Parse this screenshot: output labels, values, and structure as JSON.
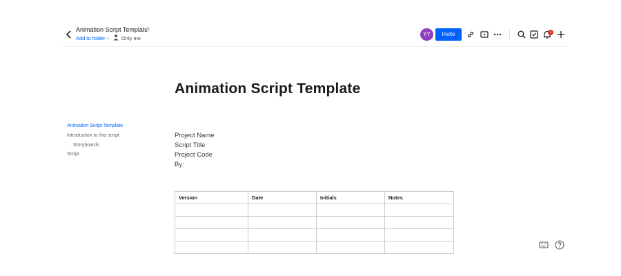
{
  "header": {
    "doc_title": "Animation Script Template",
    "add_to_folder": "Add to folder",
    "separator": "•",
    "sharing": "Only me",
    "avatar_initials": "YY",
    "invite_label": "Invite",
    "notification_count": "1",
    "icons": [
      "chevron-left-icon",
      "star-icon",
      "person-icon",
      "link-icon",
      "present-icon",
      "more-icon",
      "search-icon",
      "checklist-icon",
      "bell-icon",
      "plus-icon"
    ]
  },
  "colors": {
    "accent": "#0061fe",
    "avatar": "#8e3ec0",
    "badge": "#d1331f",
    "text": "#1e1919"
  },
  "document": {
    "title": "Animation Script Template",
    "meta_lines": [
      "Project Name",
      "Script Title",
      "Project Code",
      "By:"
    ],
    "table": {
      "headers": [
        "Version",
        "Date",
        "Initials",
        "Notes"
      ],
      "rows": [
        [
          "",
          "",
          "",
          ""
        ],
        [
          "",
          "",
          "",
          ""
        ],
        [
          "",
          "",
          "",
          ""
        ],
        [
          "",
          "",
          "",
          ""
        ]
      ]
    }
  },
  "toc": {
    "items": [
      {
        "label": "Animation Script Template",
        "active": true
      },
      {
        "label": "Introduction to this script",
        "active": false
      },
      {
        "label": "Storyboards",
        "active": false
      },
      {
        "label": "Script",
        "active": false
      }
    ]
  },
  "footer_icons": [
    "keyboard-icon",
    "help-icon"
  ]
}
